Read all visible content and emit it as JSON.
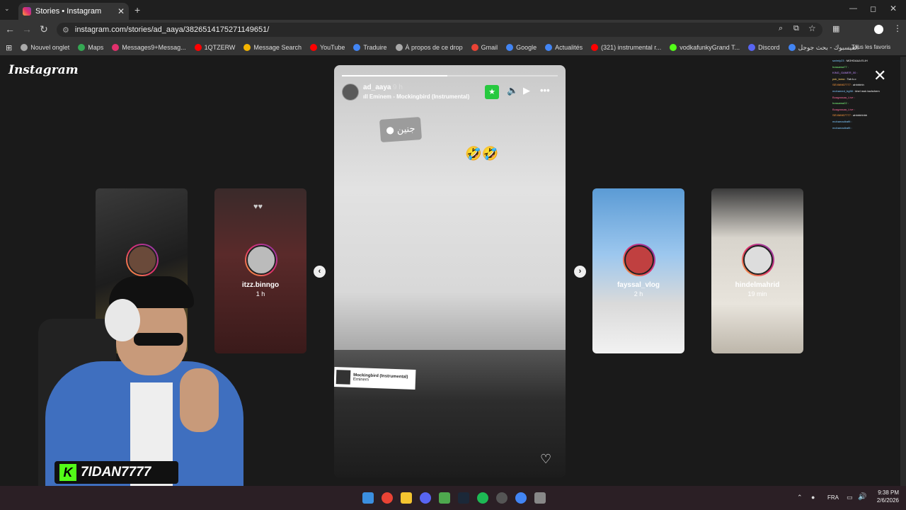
{
  "browser": {
    "tab_title": "Stories • Instagram",
    "url": "instagram.com/stories/ad_aaya/3826514175271149651/",
    "bookmarks": [
      "Nouvel onglet",
      "Maps",
      "Messages9+Messag...",
      "1QTZERW",
      "Message Search",
      "YouTube",
      "Traduire",
      "À propos de ce drop",
      "Gmail",
      "Google",
      "Actualités",
      "(321) instrumental r...",
      "vodkafunkyGrand T...",
      "Discord",
      "الفيسبوك - بحث جوجل"
    ],
    "favorites_label": "Tous les favoris"
  },
  "instagram": {
    "logo": "Instagram",
    "story": {
      "username": "ad_aaya",
      "time": "9 h",
      "song": "Eminem - Mockingbird (Instrumental)",
      "progress": 0.49,
      "location_sticker": "جنين",
      "emojis": "🤣🤣",
      "music_title": "Mockingbird (Instrumental)",
      "music_artist": "Eminem"
    },
    "side_stories": [
      {
        "name": "",
        "time": ""
      },
      {
        "name": "itzz.binngo",
        "time": "1 h"
      },
      {
        "name": "fayssal_vlog",
        "time": "2 h"
      },
      {
        "name": "hindelmahrid",
        "time": "19 min"
      }
    ]
  },
  "overlay": {
    "streamer": "7IDAN7777",
    "chat": [
      {
        "user": "swimly23 :",
        "msg": "MOHDAAA ELIH",
        "color": "#7ec8ff"
      },
      {
        "user": "hossama77 :",
        "msg": "",
        "color": "#7cff7c"
      },
      {
        "user": "KING_GAMER_00 :",
        "msg": "",
        "color": "#c08cff"
      },
      {
        "user": "psk_tama :",
        "msg": "Tah k.o",
        "color": "#ffd36b"
      },
      {
        "user": "SEVMM07777 :",
        "msg": "ahhhhhh",
        "color": "#ff9a3c"
      },
      {
        "user": "mohamed_bg58 :",
        "msg": "khel mok tachchem",
        "color": "#7ec8ff"
      },
      {
        "user": "Boagassaa_Live :",
        "msg": "",
        "color": "#ff6b9d"
      },
      {
        "user": "hossama22 :",
        "msg": "",
        "color": "#7cff7c"
      },
      {
        "user": "Boagassaa_Live :",
        "msg": "",
        "color": "#ff6b9d"
      },
      {
        "user": "SEVMM07777 :",
        "msg": "ahhhhhhhh",
        "color": "#ff9a3c"
      },
      {
        "user": "mohamadirafti :",
        "msg": "",
        "color": "#7ec8ff"
      },
      {
        "user": "mohamadirafti :",
        "msg": "",
        "color": "#7ec8ff"
      }
    ]
  },
  "taskbar": {
    "lang": "FRA",
    "time": "9:38 PM",
    "date": "2/6/2026"
  }
}
